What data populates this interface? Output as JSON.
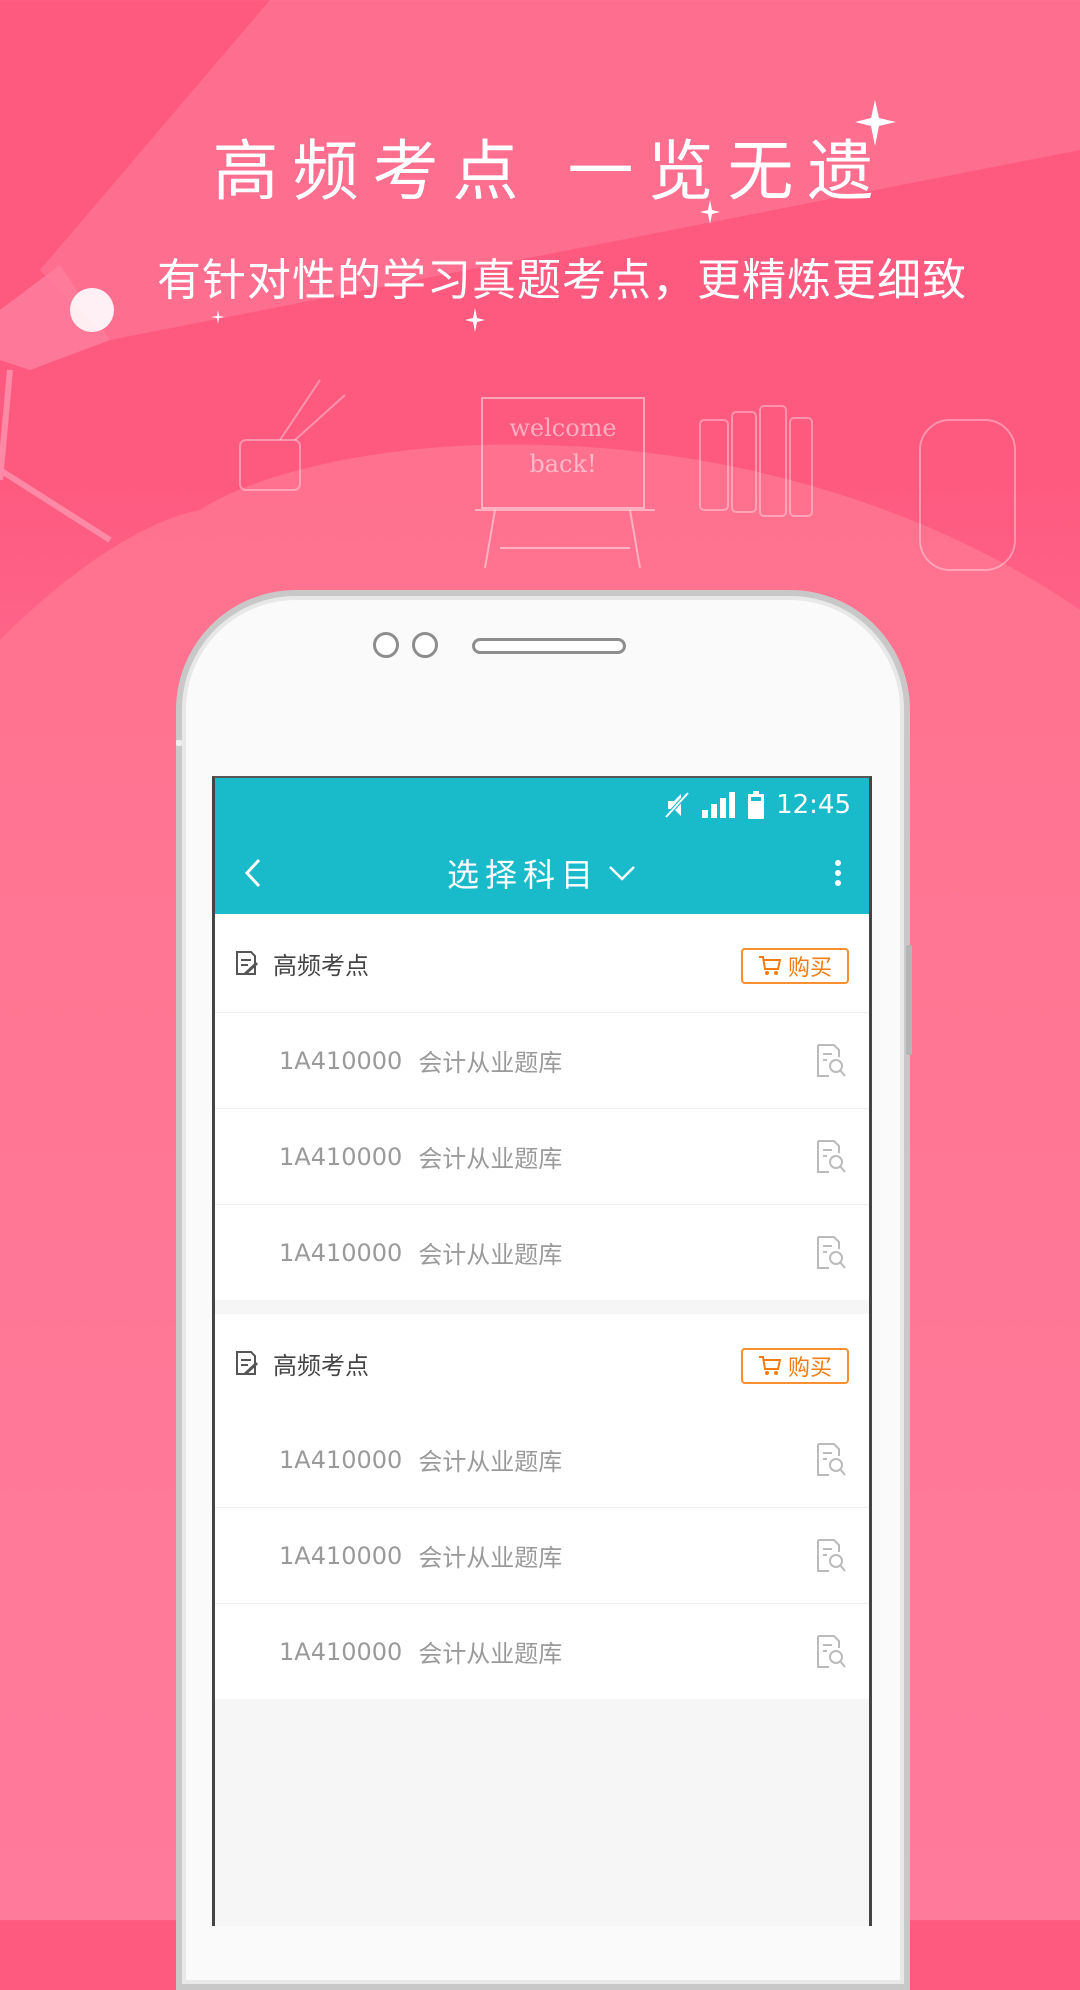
{
  "hero": {
    "title": "高频考点 一览无遗",
    "subtitle": "有针对性的学习真题考点，更精炼更细致",
    "illustration_text": "welcome back!",
    "bg_color": "#fe5a80"
  },
  "statusbar": {
    "icons": [
      "mute-icon",
      "signal-icon",
      "battery-icon"
    ],
    "time": "12:45"
  },
  "appbar": {
    "title": "选择科目",
    "accent_color": "#19bbcb"
  },
  "sections": [
    {
      "header": "高频考点",
      "buy_label": "购买",
      "items": [
        {
          "code": "1A410000",
          "name": "会计从业题库"
        },
        {
          "code": "1A410000",
          "name": "会计从业题库"
        },
        {
          "code": "1A410000",
          "name": "会计从业题库"
        }
      ]
    },
    {
      "header": "高频考点",
      "buy_label": "购买",
      "items": [
        {
          "code": "1A410000",
          "name": "会计从业题库"
        },
        {
          "code": "1A410000",
          "name": "会计从业题库"
        },
        {
          "code": "1A410000",
          "name": "会计从业题库"
        }
      ]
    }
  ],
  "colors": {
    "buy_orange": "#f37b12"
  }
}
